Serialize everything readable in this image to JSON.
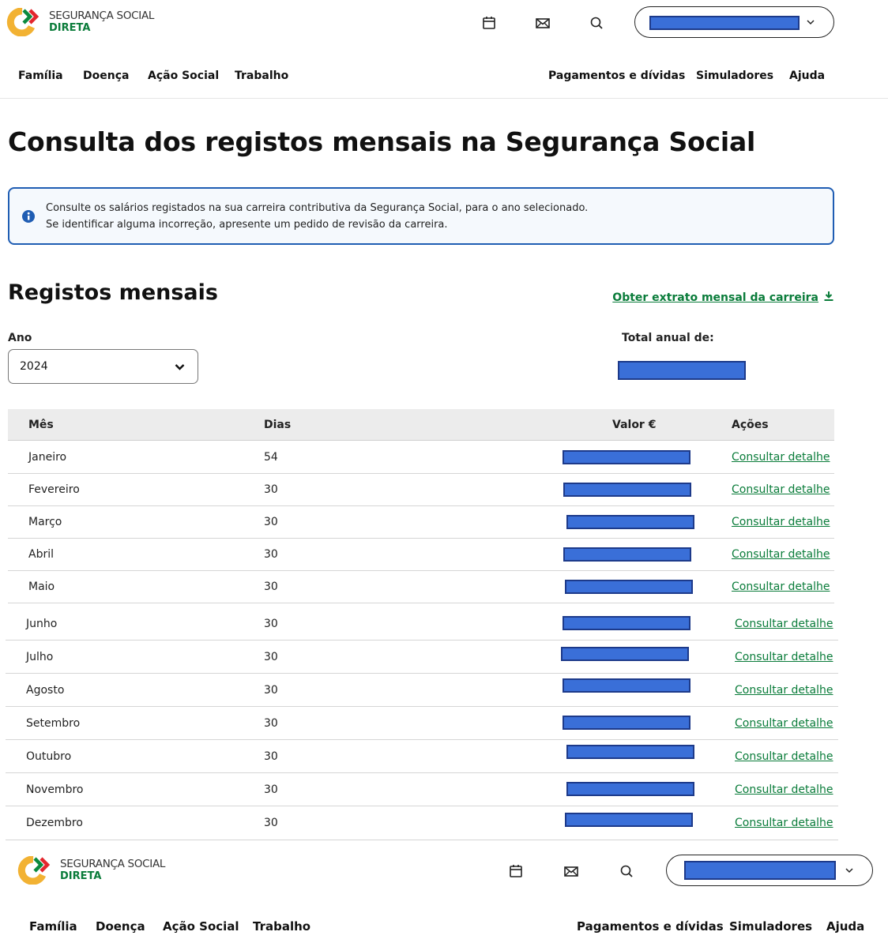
{
  "brand": {
    "line1": "SEGURANÇA SOCIAL",
    "line2": "DIRETA"
  },
  "header_icons": [
    "calendar-icon",
    "mail-icon",
    "search-icon"
  ],
  "nav_left": [
    "Família",
    "Doença",
    "Ação Social",
    "Trabalho"
  ],
  "nav_right": [
    "Pagamentos e dívidas",
    "Simuladores",
    "Ajuda"
  ],
  "page_title": "Consulta dos registos mensais na Segurança Social",
  "info": {
    "line1": "Consulte os salários registados na sua carreira contributiva da Segurança Social, para o ano selecionado.",
    "line2": "Se identificar alguma incorreção, apresente um pedido de revisão da carreira."
  },
  "section_title": "Registos mensais",
  "extract_link": "Obter extrato mensal da carreira",
  "year_label": "Ano",
  "year_value": "2024",
  "total_label": "Total anual de:",
  "table": {
    "headers": {
      "month": "Mês",
      "days": "Dias",
      "value": "Valor €",
      "actions": "Ações"
    },
    "rows": [
      {
        "month": "Janeiro",
        "days": "54",
        "action": "Consultar detalhe"
      },
      {
        "month": "Fevereiro",
        "days": "30",
        "action": "Consultar detalhe"
      },
      {
        "month": "Março",
        "days": "30",
        "action": "Consultar detalhe"
      },
      {
        "month": "Abril",
        "days": "30",
        "action": "Consultar detalhe"
      },
      {
        "month": "Maio",
        "days": "30",
        "action": "Consultar detalhe"
      },
      {
        "month": "Junho",
        "days": "30",
        "action": "Consultar detalhe"
      },
      {
        "month": "Julho",
        "days": "30",
        "action": "Consultar detalhe"
      },
      {
        "month": "Agosto",
        "days": "30",
        "action": "Consultar detalhe"
      },
      {
        "month": "Setembro",
        "days": "30",
        "action": "Consultar detalhe"
      },
      {
        "month": "Outubro",
        "days": "30",
        "action": "Consultar detalhe"
      },
      {
        "month": "Novembro",
        "days": "30",
        "action": "Consultar detalhe"
      },
      {
        "month": "Dezembro",
        "days": "30",
        "action": "Consultar detalhe"
      }
    ]
  },
  "colors": {
    "accent_green": "#0a7c3a",
    "info_border": "#1f5db3",
    "redaction": "#3a6fd8"
  }
}
